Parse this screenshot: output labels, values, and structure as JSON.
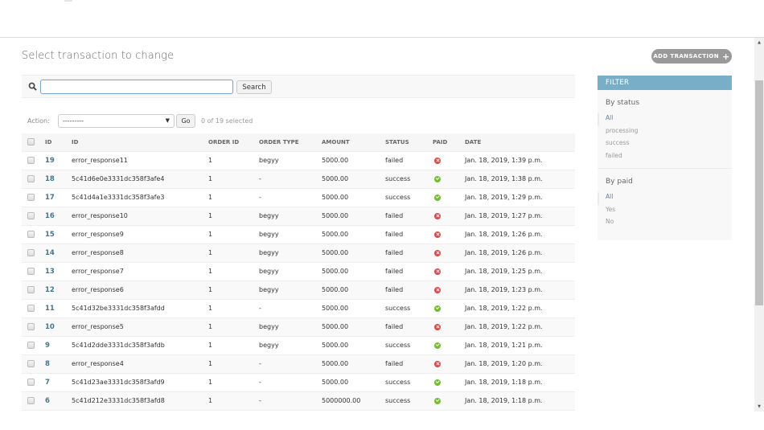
{
  "page": {
    "title": "Select transaction to change",
    "add_button_label": "ADD TRANSACTION"
  },
  "search": {
    "value": "",
    "button_label": "Search"
  },
  "actions": {
    "label": "Action:",
    "selected_option": "---------",
    "go_label": "Go",
    "counter": "0 of 19 selected"
  },
  "table": {
    "headers": [
      "ID",
      "ID",
      "ORDER ID",
      "ORDER TYPE",
      "AMOUNT",
      "STATUS",
      "PAID",
      "DATE"
    ],
    "rows": [
      {
        "pk": "19",
        "id": "error_response11",
        "order_id": "1",
        "order_type": "begyy",
        "amount": "5000.00",
        "status": "failed",
        "paid": false,
        "date": "Jan. 18, 2019, 1:39 p.m."
      },
      {
        "pk": "18",
        "id": "5c41d6e0e3331dc358f3afe4",
        "order_id": "1",
        "order_type": "-",
        "amount": "5000.00",
        "status": "success",
        "paid": true,
        "date": "Jan. 18, 2019, 1:38 p.m."
      },
      {
        "pk": "17",
        "id": "5c41d4a1e3331dc358f3afe3",
        "order_id": "1",
        "order_type": "-",
        "amount": "5000.00",
        "status": "success",
        "paid": true,
        "date": "Jan. 18, 2019, 1:29 p.m."
      },
      {
        "pk": "16",
        "id": "error_response10",
        "order_id": "1",
        "order_type": "begyy",
        "amount": "5000.00",
        "status": "failed",
        "paid": false,
        "date": "Jan. 18, 2019, 1:27 p.m."
      },
      {
        "pk": "15",
        "id": "error_response9",
        "order_id": "1",
        "order_type": "begyy",
        "amount": "5000.00",
        "status": "failed",
        "paid": false,
        "date": "Jan. 18, 2019, 1:26 p.m."
      },
      {
        "pk": "14",
        "id": "error_response8",
        "order_id": "1",
        "order_type": "begyy",
        "amount": "5000.00",
        "status": "failed",
        "paid": false,
        "date": "Jan. 18, 2019, 1:26 p.m."
      },
      {
        "pk": "13",
        "id": "error_response7",
        "order_id": "1",
        "order_type": "begyy",
        "amount": "5000.00",
        "status": "failed",
        "paid": false,
        "date": "Jan. 18, 2019, 1:25 p.m."
      },
      {
        "pk": "12",
        "id": "error_response6",
        "order_id": "1",
        "order_type": "begyy",
        "amount": "5000.00",
        "status": "failed",
        "paid": false,
        "date": "Jan. 18, 2019, 1:23 p.m."
      },
      {
        "pk": "11",
        "id": "5c41d32be3331dc358f3afdd",
        "order_id": "1",
        "order_type": "-",
        "amount": "5000.00",
        "status": "success",
        "paid": true,
        "date": "Jan. 18, 2019, 1:22 p.m."
      },
      {
        "pk": "10",
        "id": "error_response5",
        "order_id": "1",
        "order_type": "begyy",
        "amount": "5000.00",
        "status": "failed",
        "paid": false,
        "date": "Jan. 18, 2019, 1:22 p.m."
      },
      {
        "pk": "9",
        "id": "5c41d2dde3331dc358f3afdb",
        "order_id": "1",
        "order_type": "begyy",
        "amount": "5000.00",
        "status": "success",
        "paid": true,
        "date": "Jan. 18, 2019, 1:21 p.m."
      },
      {
        "pk": "8",
        "id": "error_response4",
        "order_id": "1",
        "order_type": "-",
        "amount": "5000.00",
        "status": "failed",
        "paid": false,
        "date": "Jan. 18, 2019, 1:20 p.m."
      },
      {
        "pk": "7",
        "id": "5c41d23ae3331dc358f3afd9",
        "order_id": "1",
        "order_type": "-",
        "amount": "5000.00",
        "status": "success",
        "paid": true,
        "date": "Jan. 18, 2019, 1:18 p.m."
      },
      {
        "pk": "6",
        "id": "5c41d212e3331dc358f3afd8",
        "order_id": "1",
        "order_type": "-",
        "amount": "5000000.00",
        "status": "success",
        "paid": true,
        "date": "Jan. 18, 2019, 1:18 p.m."
      }
    ]
  },
  "filter": {
    "title": "FILTER",
    "groups": [
      {
        "title": "By status",
        "options": [
          "All",
          "processing",
          "success",
          "failed"
        ],
        "selected": "All"
      },
      {
        "title": "By paid",
        "options": [
          "All",
          "Yes",
          "No"
        ],
        "selected": "All"
      }
    ]
  },
  "colors": {
    "accent": "#79aec8",
    "link": "#417690",
    "paid_yes": "#70bf2b",
    "paid_no": "#dd4646"
  }
}
